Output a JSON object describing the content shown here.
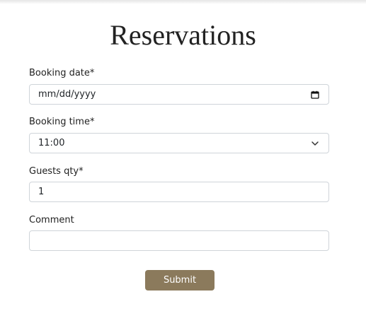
{
  "page": {
    "title": "Reservations"
  },
  "form": {
    "booking_date": {
      "label": "Booking date*",
      "placeholder": "mm/dd/yyyy",
      "icon": "calendar-icon"
    },
    "booking_time": {
      "label": "Booking time*",
      "value": "11:00",
      "icon": "chevron-down-icon"
    },
    "guests": {
      "label": "Guests qty*",
      "value": "1"
    },
    "comment": {
      "label": "Comment",
      "value": ""
    },
    "submit_label": "Submit"
  },
  "colors": {
    "submit_bg": "#8b7a5c",
    "field_border": "#cfd4d9"
  }
}
